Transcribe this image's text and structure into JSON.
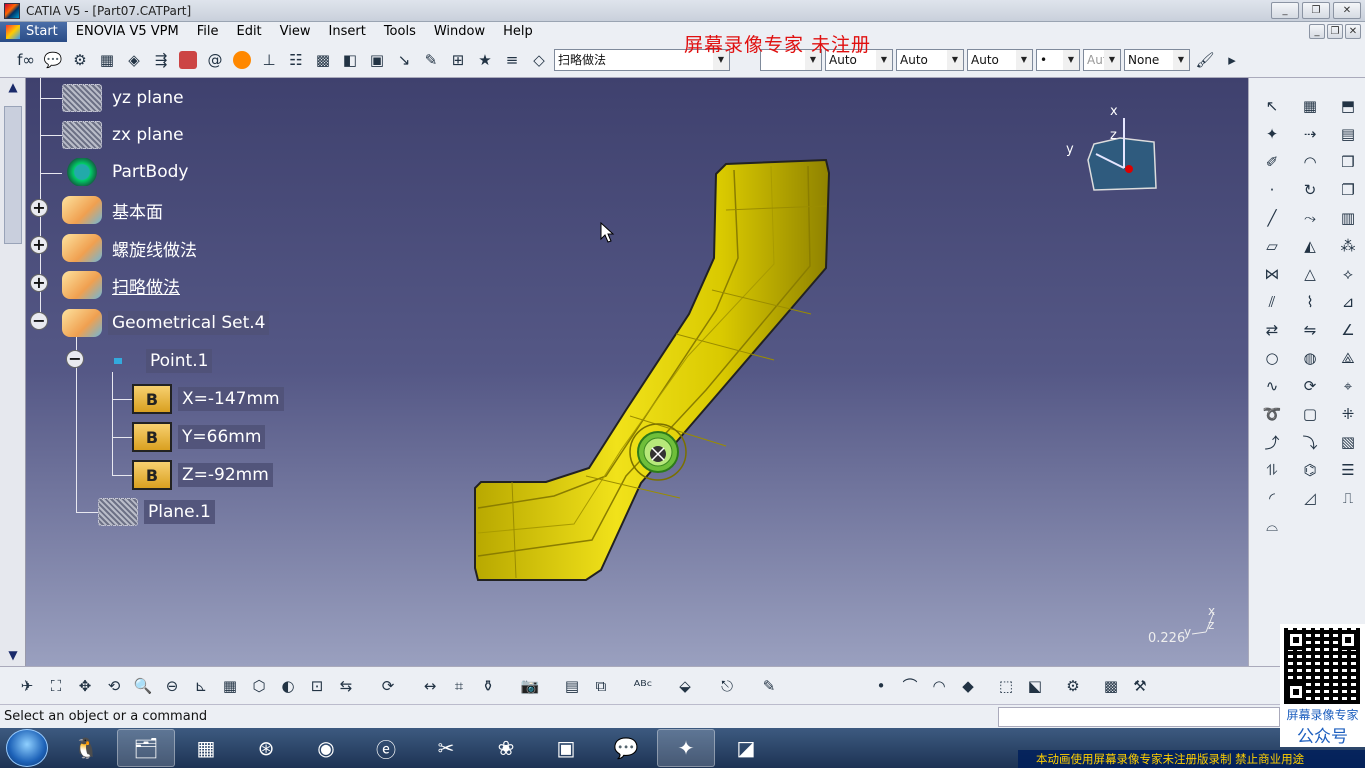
{
  "window": {
    "title": "CATIA V5 - [Part07.CATPart]",
    "btn_min": "_",
    "btn_max": "❐",
    "btn_close": "✕"
  },
  "menu": {
    "items": [
      "Start",
      "ENOVIA V5 VPM",
      "File",
      "Edit",
      "View",
      "Insert",
      "Tools",
      "Window",
      "Help"
    ]
  },
  "watermark_top": "屏幕录像专家 未注册",
  "toolbar": {
    "combo_main": "扫略做法",
    "combo_color": "",
    "combo_auto1": "Auto",
    "combo_auto2": "Auto",
    "combo_auto3": "Auto",
    "combo_dot": "•",
    "combo_aut": "Aut",
    "combo_none": "None"
  },
  "tree": {
    "yz": "yz plane",
    "zx": "zx plane",
    "partbody": "PartBody",
    "g1": "基本面",
    "g2": "螺旋线做法",
    "g3": "扫略做法",
    "g4": "Geometrical Set.4",
    "point": "Point.1",
    "x": "X=-147mm",
    "y": "Y=66mm",
    "z": "Z=-92mm",
    "plane": "Plane.1",
    "param_glyph": "B"
  },
  "compass": {
    "x": "x",
    "y": "y",
    "z": "z"
  },
  "scale": {
    "value": "0.226",
    "ax_x": "x",
    "ax_y": "y",
    "ax_z": "z"
  },
  "status": {
    "text": "Select an object or a command"
  },
  "qr": {
    "line1": "屏幕录像专家",
    "line2": "公众号"
  },
  "watermark_bottom": "本动画使用屏幕录像专家未注册版录制  禁止商业用途"
}
